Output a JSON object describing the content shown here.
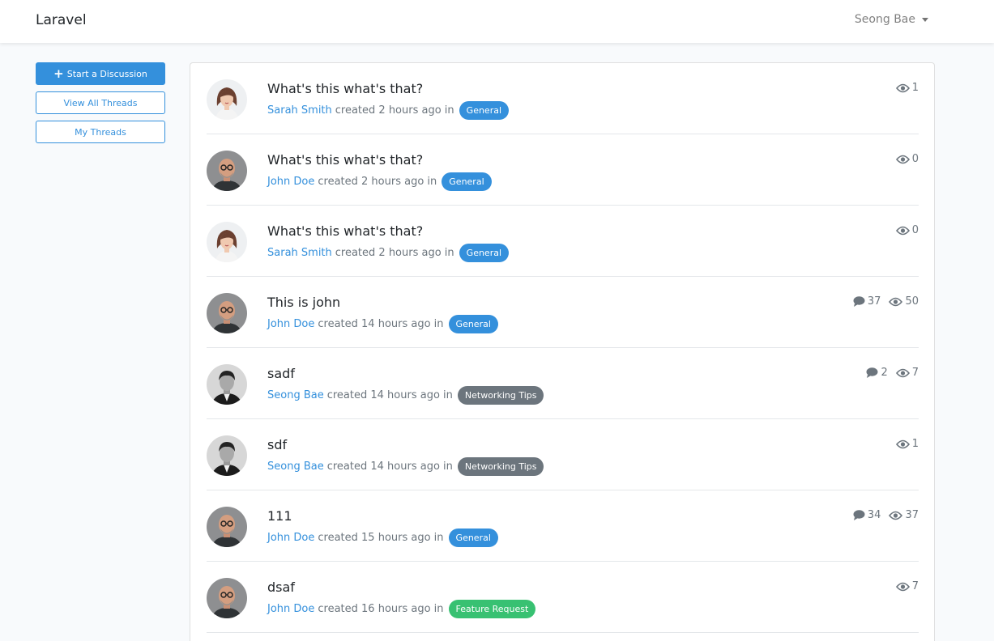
{
  "navbar": {
    "brand": "Laravel",
    "user": "Seong Bae"
  },
  "sidebar": {
    "start_discussion": "Start a Discussion",
    "view_all": "View All Threads",
    "my_threads": "My Threads"
  },
  "colors": {
    "primary": "#3490dc",
    "channel_general": "#3490dc",
    "channel_networking": "#6c757d",
    "channel_feature": "#38c172"
  },
  "threads": [
    {
      "title": "What's this what's that?",
      "author": "Sarah Smith",
      "created": "created 2 hours ago in",
      "channel": "General",
      "views": "1",
      "avatar": "woman-avatar"
    },
    {
      "title": "What's this what's that?",
      "author": "John Doe",
      "created": "created 2 hours ago in",
      "channel": "General",
      "views": "0",
      "avatar": "man-glasses-avatar"
    },
    {
      "title": "What's this what's that?",
      "author": "Sarah Smith",
      "created": "created 2 hours ago in",
      "channel": "General",
      "views": "0",
      "avatar": "woman-avatar"
    },
    {
      "title": "This is john",
      "author": "John Doe",
      "created": "created 14 hours ago in",
      "channel": "General",
      "replies": "37",
      "views": "50",
      "avatar": "man-glasses-avatar"
    },
    {
      "title": "sadf",
      "author": "Seong Bae",
      "created": "created 14 hours ago in",
      "channel": "Networking Tips",
      "replies": "2",
      "views": "7",
      "avatar": "man-suit-avatar"
    },
    {
      "title": "sdf",
      "author": "Seong Bae",
      "created": "created 14 hours ago in",
      "channel": "Networking Tips",
      "views": "1",
      "avatar": "man-suit-avatar"
    },
    {
      "title": "111",
      "author": "John Doe",
      "created": "created 15 hours ago in",
      "channel": "General",
      "replies": "34",
      "views": "37",
      "avatar": "man-glasses-avatar"
    },
    {
      "title": "dsaf",
      "author": "John Doe",
      "created": "created 16 hours ago in",
      "channel": "Feature Request",
      "views": "7",
      "avatar": "man-glasses-avatar"
    }
  ]
}
